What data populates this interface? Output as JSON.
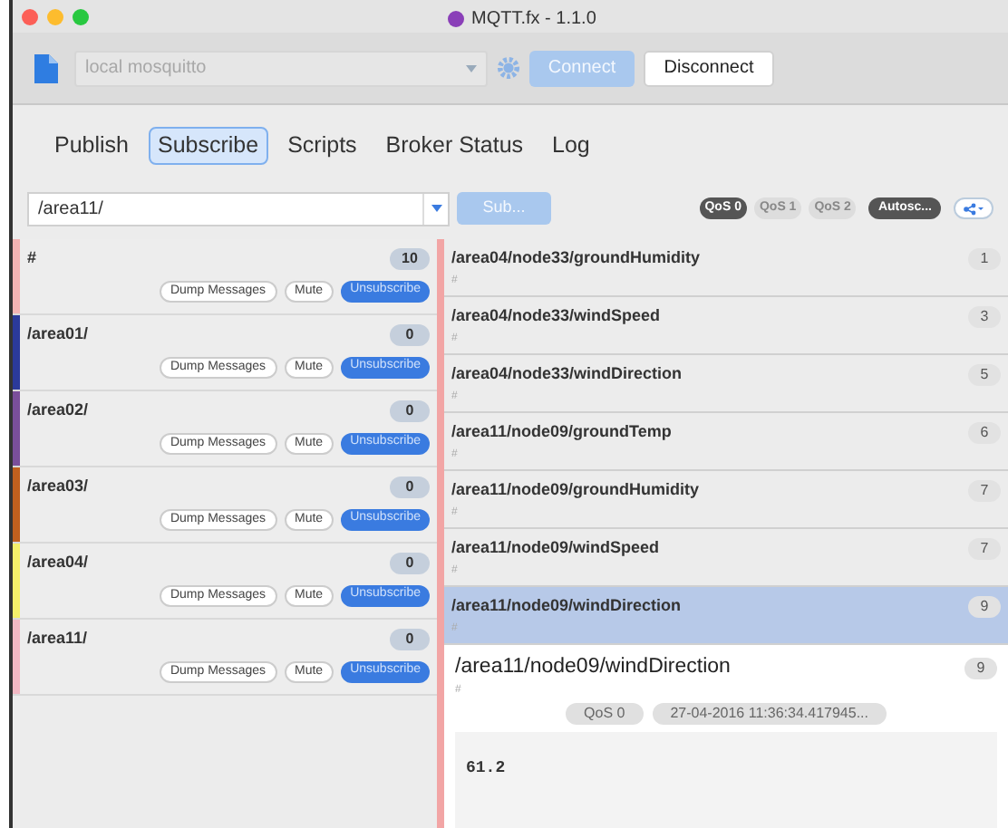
{
  "window": {
    "title": "MQTT.fx - 1.1.0"
  },
  "toolbar": {
    "profile_placeholder": "local mosquitto",
    "connect": {
      "label": "Connect",
      "disabled": true
    },
    "disconnect": {
      "label": "Disconnect",
      "disabled": false
    }
  },
  "tabs": [
    {
      "label": "Publish",
      "selected": false
    },
    {
      "label": "Subscribe",
      "selected": true
    },
    {
      "label": "Scripts",
      "selected": false
    },
    {
      "label": "Broker Status",
      "selected": false
    },
    {
      "label": "Log",
      "selected": false
    }
  ],
  "subscribe_bar": {
    "topic": "/area11/",
    "subscribe_button": {
      "label": "Sub...",
      "disabled": true
    },
    "qos": [
      {
        "label": "QoS 0",
        "selected": true
      },
      {
        "label": "QoS 1",
        "selected": false
      },
      {
        "label": "QoS 2",
        "selected": false
      }
    ],
    "autoscroll": {
      "label": "Autosc...",
      "on": true
    }
  },
  "subscriptions": [
    {
      "topic": "#",
      "count": "10",
      "color": "#f2b3b3",
      "dump": "Dump Messages",
      "mute": "Mute",
      "unsubscribe": "Unsubscribe"
    },
    {
      "topic": "/area01/",
      "count": "0",
      "color": "#2b3a9a",
      "dump": "Dump Messages",
      "mute": "Mute",
      "unsubscribe": "Unsubscribe"
    },
    {
      "topic": "/area02/",
      "count": "0",
      "color": "#7a4f9a",
      "dump": "Dump Messages",
      "mute": "Mute",
      "unsubscribe": "Unsubscribe"
    },
    {
      "topic": "/area03/",
      "count": "0",
      "color": "#c0601e",
      "dump": "Dump Messages",
      "mute": "Mute",
      "unsubscribe": "Unsubscribe"
    },
    {
      "topic": "/area04/",
      "count": "0",
      "color": "#f5f06a",
      "dump": "Dump Messages",
      "mute": "Mute",
      "unsubscribe": "Unsubscribe"
    },
    {
      "topic": "/area11/",
      "count": "0",
      "color": "#f2b8c4",
      "dump": "Dump Messages",
      "mute": "Mute",
      "unsubscribe": "Unsubscribe"
    }
  ],
  "messages": [
    {
      "topic": "/area04/node33/groundHumidity",
      "subscription": "#",
      "count": "1",
      "selected": false
    },
    {
      "topic": "/area04/node33/windSpeed",
      "subscription": "#",
      "count": "3",
      "selected": false
    },
    {
      "topic": "/area04/node33/windDirection",
      "subscription": "#",
      "count": "5",
      "selected": false
    },
    {
      "topic": "/area11/node09/groundTemp",
      "subscription": "#",
      "count": "6",
      "selected": false
    },
    {
      "topic": "/area11/node09/groundHumidity",
      "subscription": "#",
      "count": "7",
      "selected": false
    },
    {
      "topic": "/area11/node09/windSpeed",
      "subscription": "#",
      "count": "7",
      "selected": false
    },
    {
      "topic": "/area11/node09/windDirection",
      "subscription": "#",
      "count": "9",
      "selected": true
    }
  ],
  "detail": {
    "topic": "/area11/node09/windDirection",
    "subscription": "#",
    "count": "9",
    "qos": "QoS 0",
    "timestamp": "27-04-2016 11:36:34.417945...",
    "payload": "61.2"
  }
}
